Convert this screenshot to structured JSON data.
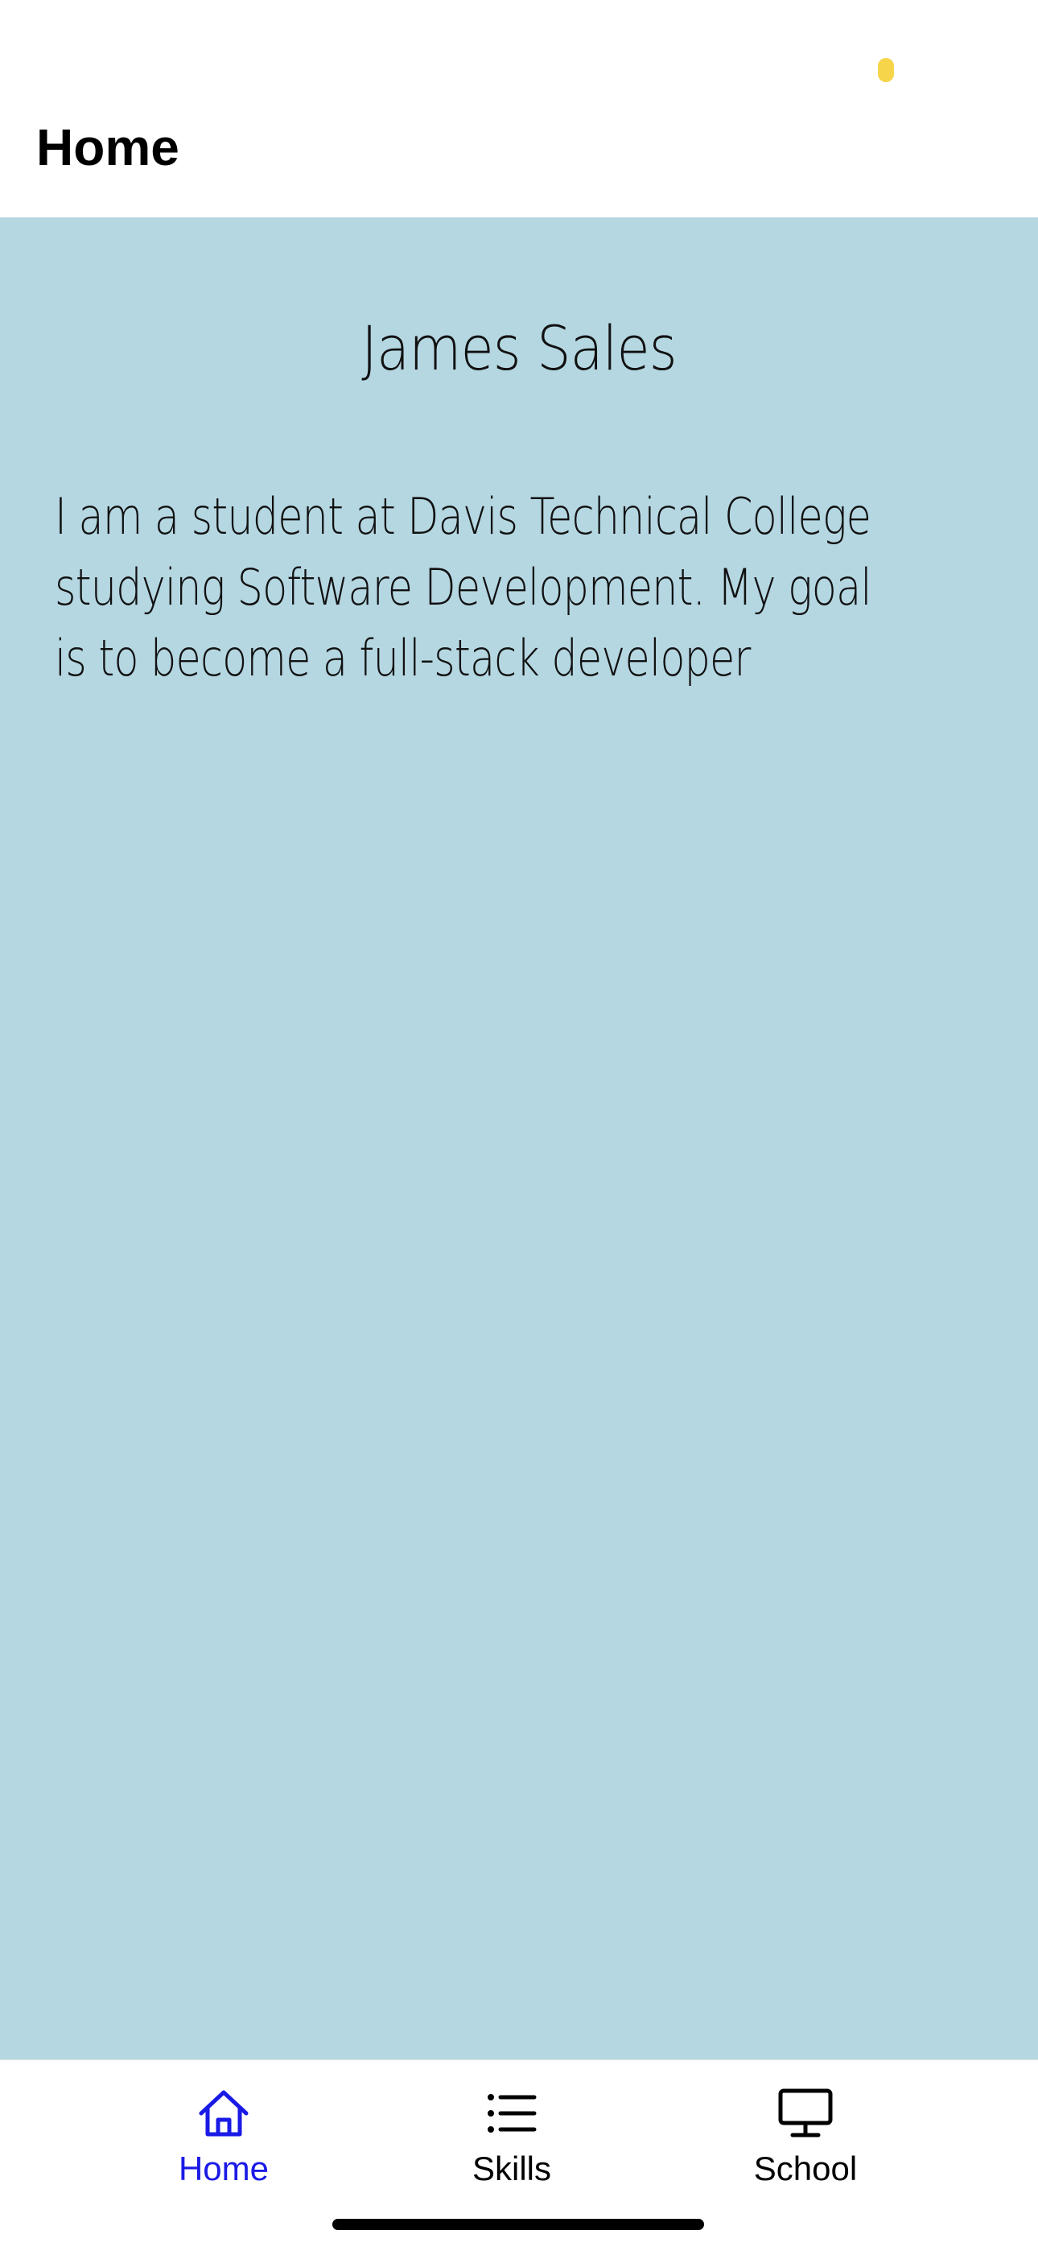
{
  "colors": {
    "content_bg": "#b5d7e2",
    "active_tab": "#1a1ae6",
    "inactive_tab": "#000000",
    "status_dot": "#f7d54a"
  },
  "header": {
    "title": "Home"
  },
  "profile": {
    "name": "James Sales",
    "bio": "I am a student at Davis Technical College studying Software Development. My goal is to become a full-stack developer"
  },
  "tabs": [
    {
      "label": "Home",
      "icon": "home-icon",
      "active": true
    },
    {
      "label": "Skills",
      "icon": "list-icon",
      "active": false
    },
    {
      "label": "School",
      "icon": "monitor-icon",
      "active": false
    }
  ]
}
